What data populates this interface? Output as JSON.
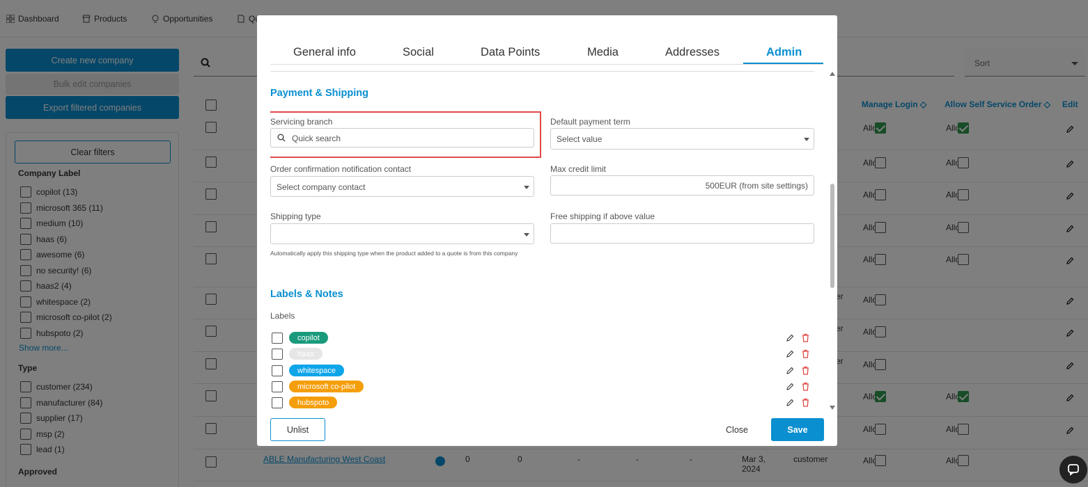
{
  "nav": {
    "items": [
      {
        "label": "Dashboard",
        "icon": "grid-icon"
      },
      {
        "label": "Products",
        "icon": "store-icon"
      },
      {
        "label": "Opportunities",
        "icon": "lightbulb-icon"
      },
      {
        "label": "Qu",
        "icon": "document-icon"
      }
    ]
  },
  "sidebar": {
    "create_label": "Create new company",
    "bulk_label": "Bulk edit companies",
    "export_label": "Export filtered companies",
    "clear_label": "Clear filters",
    "company_label_heading": "Company Label",
    "company_labels": [
      "copilot (13)",
      "microsoft 365 (11)",
      "medium (10)",
      "haas (6)",
      "awesome (6)",
      "no security! (6)",
      "haas2 (4)",
      "whitespace (2)",
      "microsoft co-pilot (2)",
      "hubspoto (2)"
    ],
    "show_more": "Show more...",
    "type_heading": "Type",
    "types": [
      "customer (234)",
      "manufacturer (84)",
      "supplier (17)",
      "msp (2)",
      "lead (1)"
    ],
    "approved_heading": "Approved"
  },
  "table": {
    "sort_placeholder": "Sort",
    "headers": {
      "manage_login": "Manage Login",
      "self_service": "Allow Self Service Order",
      "edit": "Edit"
    },
    "allow_label": "Allow",
    "partial_text": "er",
    "last_row": {
      "name": "ABLE Manufacturing West Coast",
      "c1": "0",
      "c2": "0",
      "d1": "-",
      "d2": "-",
      "d3": "-",
      "date": "Mar 3, 2024",
      "type": "customer"
    }
  },
  "modal": {
    "tabs": [
      "General info",
      "Social",
      "Data Points",
      "Media",
      "Addresses",
      "Admin"
    ],
    "active_tab": "Admin",
    "payment_title": "Payment & Shipping",
    "servicing_branch": {
      "label": "Servicing branch",
      "placeholder": "Quick search"
    },
    "default_payment_term": {
      "label": "Default payment term",
      "value": "Select value"
    },
    "order_confirmation": {
      "label": "Order confirmation notification contact",
      "value": "Select company contact"
    },
    "max_credit": {
      "label": "Max credit limit",
      "value": "500EUR (from site settings)"
    },
    "shipping_type": {
      "label": "Shipping type",
      "value": "",
      "hint": "Automatically apply this shipping type when the product added to a quote is from this company"
    },
    "free_shipping": {
      "label": "Free shipping if above value",
      "value": ""
    },
    "labels_title": "Labels & Notes",
    "labels_subtitle": "Labels",
    "labels": [
      {
        "name": "copilot",
        "color": "#1a9a7c"
      },
      {
        "name": "haas",
        "color": "#e6e6e6"
      },
      {
        "name": "whitespace",
        "color": "#0ea5e9"
      },
      {
        "name": "microsoft co-pilot",
        "color": "#f59e0b"
      },
      {
        "name": "hubspoto",
        "color": "#f59e0b"
      }
    ],
    "unlist_label": "Unlist",
    "close_label": "Close",
    "save_label": "Save"
  },
  "colors": {
    "accent": "#0a8fd0",
    "highlight": "#e04848",
    "delete": "#e04848"
  }
}
